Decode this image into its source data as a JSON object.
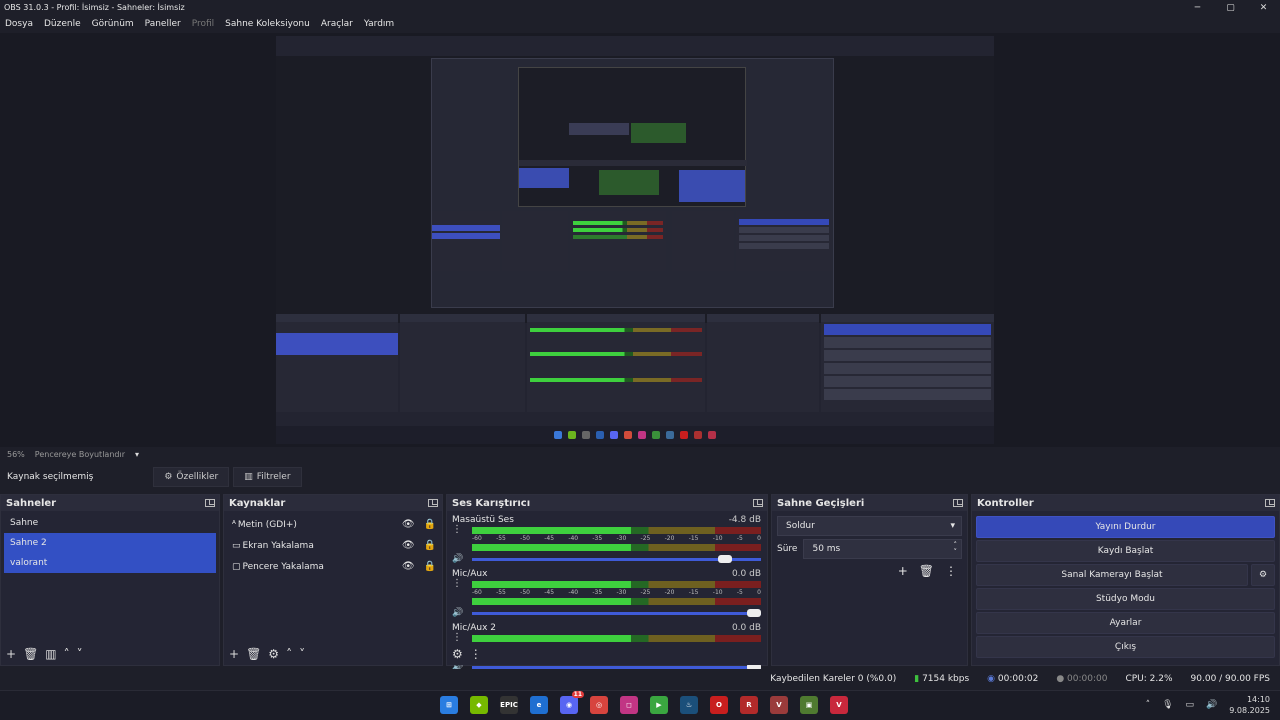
{
  "window": {
    "title": "OBS 31.0.3 - Profil: İsimsiz - Sahneler: İsimsiz",
    "minimize": "─",
    "maximize": "▢",
    "close": "✕"
  },
  "menu": [
    {
      "label": "Dosya"
    },
    {
      "label": "Düzenle"
    },
    {
      "label": "Görünüm"
    },
    {
      "label": "Paneller"
    },
    {
      "label": "Profil",
      "disabled": true
    },
    {
      "label": "Sahne Koleksiyonu"
    },
    {
      "label": "Araçlar"
    },
    {
      "label": "Yardım"
    }
  ],
  "zoom": {
    "value": "56%",
    "mode": "Pencereye Boyutlandır"
  },
  "source_bar": {
    "status": "Kaynak seçilmemiş",
    "properties": "Özellikler",
    "filters": "Filtreler"
  },
  "scenes": {
    "title": "Sahneler",
    "items": [
      "Sahne",
      "Sahne 2",
      "valorant"
    ],
    "selected": [
      1,
      2
    ]
  },
  "sources": {
    "title": "Kaynaklar",
    "items": [
      {
        "icon": "text-icon",
        "label": "Metin (GDI+)"
      },
      {
        "icon": "monitor-icon",
        "label": "Ekran Yakalama"
      },
      {
        "icon": "window-icon",
        "label": "Pencere Yakalama"
      }
    ]
  },
  "mixer": {
    "title": "Ses Karıştırıcı",
    "scale": [
      "-60",
      "-55",
      "-50",
      "-45",
      "-40",
      "-35",
      "-30",
      "-25",
      "-20",
      "-15",
      "-10",
      "-5",
      "0"
    ],
    "channels": [
      {
        "name": "Masaüstü Ses",
        "db": "-4.8 dB",
        "active": true,
        "volume": 0.9
      },
      {
        "name": "Mic/Aux",
        "db": "0.0 dB",
        "active": true,
        "volume": 1.0
      },
      {
        "name": "Mic/Aux 2",
        "db": "0.0 dB",
        "active": true,
        "volume": 1.0
      }
    ]
  },
  "transitions": {
    "title": "Sahne Geçişleri",
    "selected": "Soldur",
    "duration_label": "Süre",
    "duration": "50 ms"
  },
  "controls": {
    "title": "Kontroller",
    "buttons": [
      "Yayını Durdur",
      "Kaydı Başlat",
      "Sanal Kamerayı Başlat",
      "Stüdyo Modu",
      "Ayarlar",
      "Çıkış"
    ]
  },
  "status": {
    "dropped": "Kaybedilen Kareler 0 (%0.0)",
    "bitrate": "7154 kbps",
    "stream_time": "00:00:02",
    "rec_time": "00:00:00",
    "cpu": "CPU: 2.2%",
    "fps": "90.00 / 90.00 FPS"
  },
  "taskbar": {
    "apps": [
      "windows-icon",
      "nvidia-icon",
      "epic-games-icon",
      "edge-icon",
      "discord-icon",
      "chrome-icon",
      "instagram-icon",
      "game-launcher-icon",
      "steam-icon",
      "opera-icon",
      "riot-icon",
      "valorant-icon",
      "minecraft-icon",
      "valorant-icon-2"
    ],
    "discord_badge": "11",
    "time": "14:10",
    "date": "9.08.2025"
  },
  "colors": {
    "accent": "#3549b8",
    "selected": "#3350c4",
    "bg": "#1e1f29",
    "panel": "#242534"
  }
}
